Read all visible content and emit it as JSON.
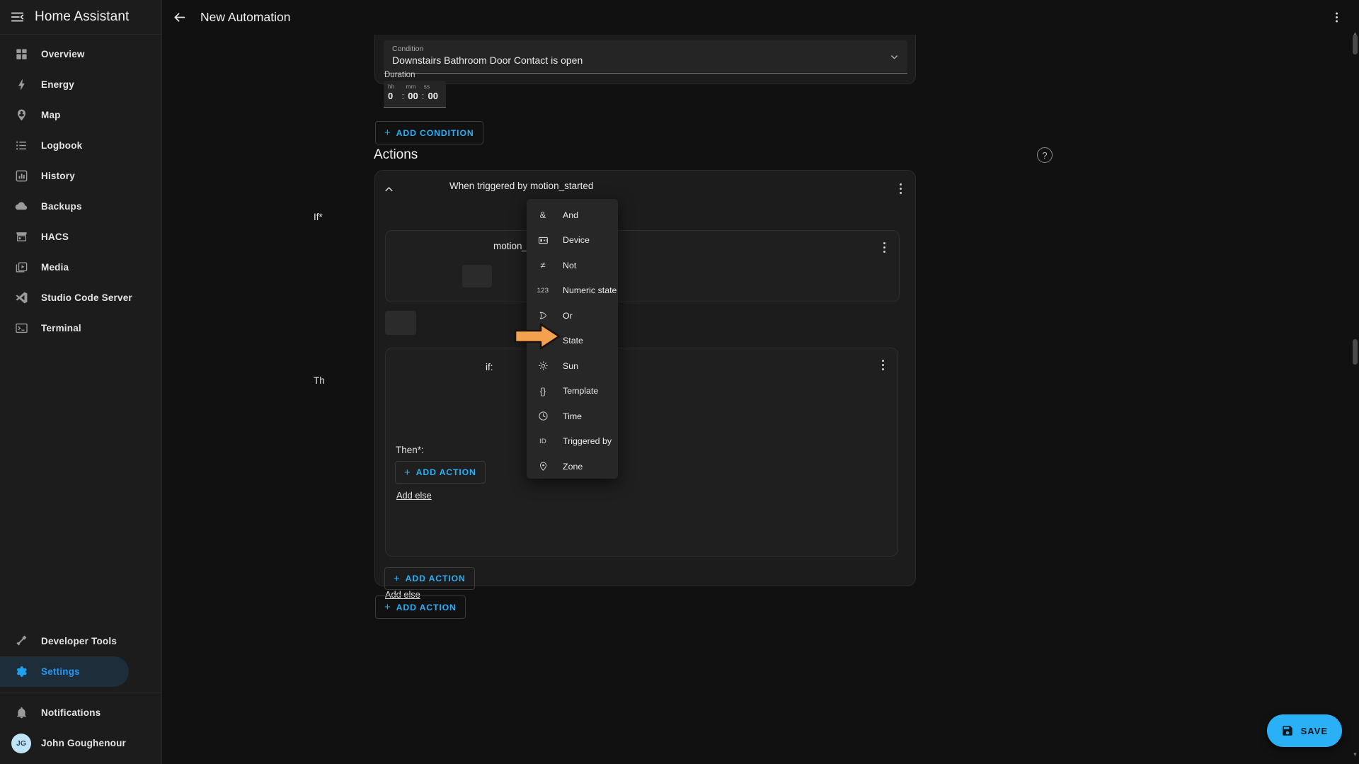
{
  "sidebar": {
    "title": "Home Assistant",
    "menu_icon": "hamburger-collapse-icon",
    "items": [
      {
        "label": "Overview",
        "icon": "view-dashboard-icon"
      },
      {
        "label": "Energy",
        "icon": "lightning-bolt-icon"
      },
      {
        "label": "Map",
        "icon": "map-marker-account-icon"
      },
      {
        "label": "Logbook",
        "icon": "format-list-bulleted-icon"
      },
      {
        "label": "History",
        "icon": "chart-box-icon"
      },
      {
        "label": "Backups",
        "icon": "cloud-icon"
      },
      {
        "label": "HACS",
        "icon": "storefront-icon"
      },
      {
        "label": "Media",
        "icon": "play-box-multiple-icon"
      },
      {
        "label": "Studio Code Server",
        "icon": "vscode-icon"
      },
      {
        "label": "Terminal",
        "icon": "console-icon"
      }
    ],
    "bottom_items": [
      {
        "label": "Developer Tools",
        "icon": "hammer-icon",
        "selected": false
      },
      {
        "label": "Settings",
        "icon": "cog-icon",
        "selected": true
      }
    ],
    "footer_items": [
      {
        "label": "Notifications",
        "icon": "bell-icon"
      },
      {
        "label": "John Goughenour",
        "icon": "avatar",
        "initials": "JG"
      }
    ]
  },
  "topbar": {
    "back_icon": "arrow-left-icon",
    "title": "New Automation",
    "overflow_icon": "dots-vertical-icon"
  },
  "condition_card": {
    "field_label": "Condition",
    "field_value": "Downstairs Bathroom Door Contact is open",
    "caret_icon": "chevron-down-icon",
    "duration_label": "Duration",
    "duration": {
      "hh_head": "hh",
      "mm_head": "mm",
      "ss_head": "ss",
      "hh": "0",
      "mm": "00",
      "ss": "00",
      "sep": ":"
    }
  },
  "add_condition_button": {
    "label": "ADD CONDITION",
    "plus": "+"
  },
  "actions_section": {
    "title": "Actions",
    "help_icon": "help-circle-icon",
    "help_glyph": "?"
  },
  "action_card": {
    "collapse_icon": "chevron-up-icon",
    "header_text": "When triggered by motion_started",
    "overflow_icon": "dots-vertical-icon",
    "if_label": "If*",
    "inner_one_text": "motion_started",
    "inner_two_text": "if:",
    "then_label": "Then*:",
    "add_action_inner": {
      "label": "ADD ACTION",
      "plus": "+"
    },
    "add_else_inner": "Add else",
    "add_action_outer": {
      "label": "ADD ACTION",
      "plus": "+"
    },
    "add_else_outer": "Add else"
  },
  "add_action_bottom": {
    "label": "ADD ACTION",
    "plus": "+"
  },
  "condition_menu": {
    "items": [
      {
        "label": "And",
        "icon": "ampersand-icon",
        "glyph": "&"
      },
      {
        "label": "Device",
        "icon": "device-icon",
        "glyph": ""
      },
      {
        "label": "Not",
        "icon": "not-equal-icon",
        "glyph": "≠"
      },
      {
        "label": "Numeric state",
        "icon": "numeric-123-icon",
        "glyph": "123"
      },
      {
        "label": "Or",
        "icon": "logic-or-gate-icon",
        "glyph": ""
      },
      {
        "label": "State",
        "icon": "state-machine-icon",
        "glyph": ""
      },
      {
        "label": "Sun",
        "icon": "weather-sunny-icon",
        "glyph": ""
      },
      {
        "label": "Template",
        "icon": "code-braces-icon",
        "glyph": "{}"
      },
      {
        "label": "Time",
        "icon": "clock-outline-icon",
        "glyph": ""
      },
      {
        "label": "Triggered by",
        "icon": "identifier-icon",
        "glyph": "ID"
      },
      {
        "label": "Zone",
        "icon": "map-marker-icon",
        "glyph": ""
      }
    ],
    "highlighted_item": "State"
  },
  "annotation": {
    "arrow_icon": "orange-right-arrow",
    "points_at": "State"
  },
  "save_button": {
    "label": "SAVE",
    "icon": "content-save-icon"
  },
  "colors": {
    "accent": "#29b0f7",
    "background": "#111111",
    "sidebar": "#1c1c1c",
    "card": "#1c1c1c",
    "menu": "#272727",
    "arrow": "#f4a14e",
    "selected_item_bg": "#1d2d3a"
  }
}
